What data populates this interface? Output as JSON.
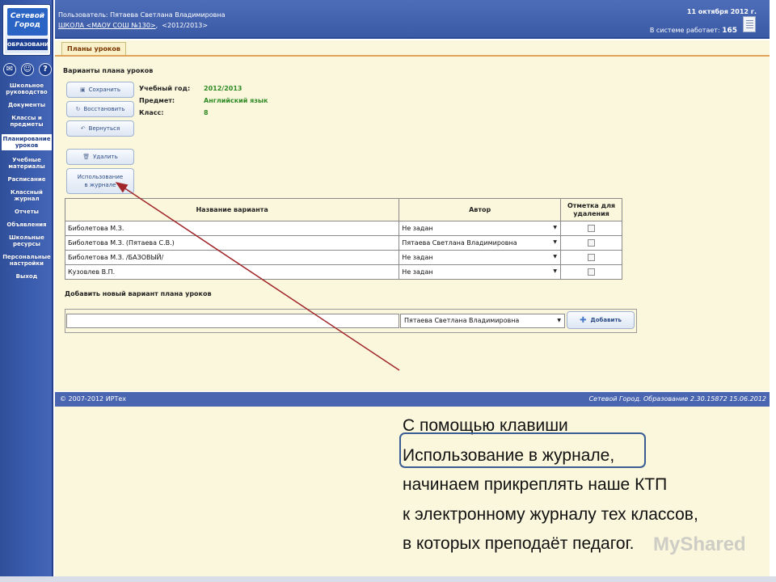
{
  "logo": {
    "line1": "Сетевой Город",
    "line2": "ОБРАЗОВАНИЕ"
  },
  "top_icons": [
    "mail-icon",
    "users-icon",
    "help-icon"
  ],
  "sidebar": {
    "items": [
      {
        "label": "Школьное руководство",
        "active": false
      },
      {
        "label": "Документы",
        "active": false
      },
      {
        "label": "Классы и предметы",
        "active": false
      },
      {
        "label": "Планирование уроков",
        "active": true
      },
      {
        "label": "Учебные материалы",
        "active": false
      },
      {
        "label": "Расписание",
        "active": false
      },
      {
        "label": "Классный журнал",
        "active": false
      },
      {
        "label": "Отчеты",
        "active": false
      },
      {
        "label": "Объявления",
        "active": false
      },
      {
        "label": "Школьные ресурсы",
        "active": false
      },
      {
        "label": "Персональные настройки",
        "active": false
      },
      {
        "label": "Выход",
        "active": false
      }
    ]
  },
  "header": {
    "user": "Пользователь: Пятаева Светлана Владимировна",
    "school": "ШКОЛА <МАОУ СОШ №130>",
    "year": "<2012/2013>",
    "date": "11 октября 2012 г.",
    "online_label": "В системе работает:",
    "online_count": "165"
  },
  "tab": {
    "label": "Планы уроков"
  },
  "page": {
    "title": "Варианты плана уроков",
    "buttons": {
      "save": "Сохранить",
      "restore": "Восстановить",
      "back": "Вернуться",
      "delete": "Удалить",
      "use_line1": "Использование",
      "use_line2": "в журнале"
    },
    "info": {
      "year_label": "Учебный год:",
      "year_value": "2012/2013",
      "subject_label": "Предмет:",
      "subject_value": "Английский язык",
      "class_label": "Класс:",
      "class_value": "8"
    }
  },
  "table": {
    "headers": {
      "name": "Название варианта",
      "author": "Автор",
      "mark_line1": "Отметка для",
      "mark_line2": "удаления"
    },
    "rows": [
      {
        "name": "Биболетова М.З.",
        "author": "Не задан"
      },
      {
        "name": "Биболетова М.З. (Пятаева С.В.)",
        "author": "Пятаева Светлана Владимировна"
      },
      {
        "name": "Биболетова М.З. /БАЗОВЫЙ/",
        "author": "Не задан"
      },
      {
        "name": "Кузовлев В.П.",
        "author": "Не задан"
      }
    ]
  },
  "add_section": {
    "title": "Добавить новый вариант плана уроков",
    "input_value": "",
    "author_selected": "Пятаева Светлана Владимировна",
    "add_label": "Добавить"
  },
  "footer": {
    "copyright": "© 2007-2012 ИРТех",
    "version": "Сетевой Город. Образование 2.30.15872   15.06.2012"
  },
  "explanation": {
    "line1": "С помощью клавиши",
    "line2": "Использование в журнале,",
    "line3": "начинаем прикреплять наше КТП",
    "line4": "к электронному журналу тех классов,",
    "line5": "в которых преподаёт педагог."
  },
  "watermark": "MyShared",
  "colors": {
    "sidebar": "#3a5cae",
    "content_bg": "#fbf7dc",
    "accent_green": "#2e8a24",
    "arrow_red": "#a0262a",
    "highlight_box": "#3a5d96"
  }
}
